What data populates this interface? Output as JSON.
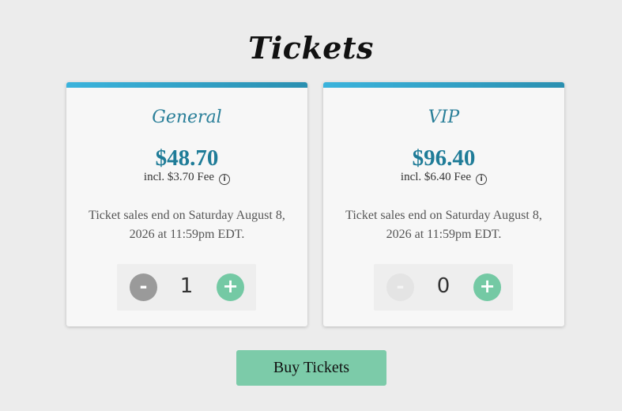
{
  "page": {
    "title": "Tickets"
  },
  "tickets": [
    {
      "name": "General",
      "price": "$48.70",
      "fee": "incl. $3.70 Fee",
      "sale_end": "Ticket sales end on Saturday August 8, 2026 at 11:59pm EDT.",
      "quantity": "1",
      "minus_label": "-",
      "plus_label": "+",
      "minus_disabled": false,
      "info_icon": "info-icon"
    },
    {
      "name": "VIP",
      "price": "$96.40",
      "fee": "incl. $6.40 Fee",
      "sale_end": "Ticket sales end on Saturday August 8, 2026 at 11:59pm EDT.",
      "quantity": "0",
      "minus_label": "-",
      "plus_label": "+",
      "minus_disabled": true,
      "info_icon": "info-icon"
    }
  ],
  "actions": {
    "buy_label": "Buy Tickets"
  },
  "colors": {
    "accent_bar": "#2a8fb0",
    "tier_name": "#2a7f99",
    "price": "#1f7c98",
    "plus_button": "#74c9a4",
    "buy_button": "#7ccba9",
    "minus_button": "#9a9a9a"
  }
}
